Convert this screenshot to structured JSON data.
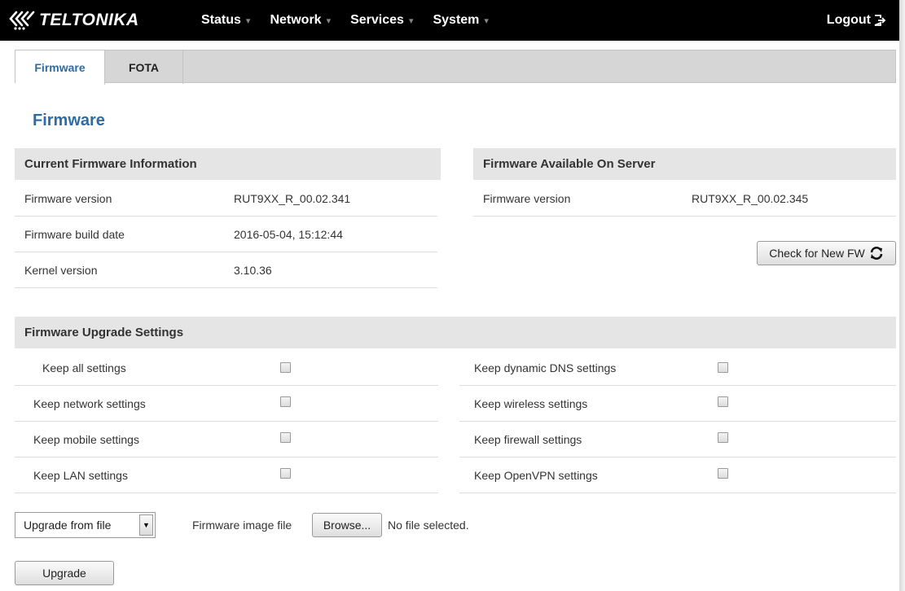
{
  "navbar": {
    "brand": "TELTONIKA",
    "menu": [
      {
        "label": "Status"
      },
      {
        "label": "Network"
      },
      {
        "label": "Services"
      },
      {
        "label": "System"
      }
    ],
    "logout": "Logout"
  },
  "tabs": [
    {
      "label": "Firmware",
      "active": true
    },
    {
      "label": "FOTA",
      "active": false
    }
  ],
  "page_title": "Firmware",
  "current_fw": {
    "title": "Current Firmware Information",
    "rows": [
      {
        "label": "Firmware version",
        "value": "RUT9XX_R_00.02.341"
      },
      {
        "label": "Firmware build date",
        "value": "2016-05-04, 15:12:44"
      },
      {
        "label": "Kernel version",
        "value": "3.10.36"
      }
    ]
  },
  "server_fw": {
    "title": "Firmware Available On Server",
    "rows": [
      {
        "label": "Firmware version",
        "value": "RUT9XX_R_00.02.345"
      }
    ],
    "check_button": "Check for New FW"
  },
  "upgrade_settings": {
    "title": "Firmware Upgrade Settings",
    "left": [
      {
        "label": "Keep all settings",
        "checked": false
      },
      {
        "label": "Keep network settings",
        "checked": false
      },
      {
        "label": "Keep mobile settings",
        "checked": false
      },
      {
        "label": "Keep LAN settings",
        "checked": false
      }
    ],
    "right": [
      {
        "label": "Keep dynamic DNS settings",
        "checked": false
      },
      {
        "label": "Keep wireless settings",
        "checked": false
      },
      {
        "label": "Keep firewall settings",
        "checked": false
      },
      {
        "label": "Keep OpenVPN settings",
        "checked": false
      }
    ]
  },
  "upload": {
    "source_selected": "Upgrade from file",
    "file_label": "Firmware image file",
    "browse_button": "Browse...",
    "file_status": "No file selected.",
    "upgrade_button": "Upgrade"
  }
}
